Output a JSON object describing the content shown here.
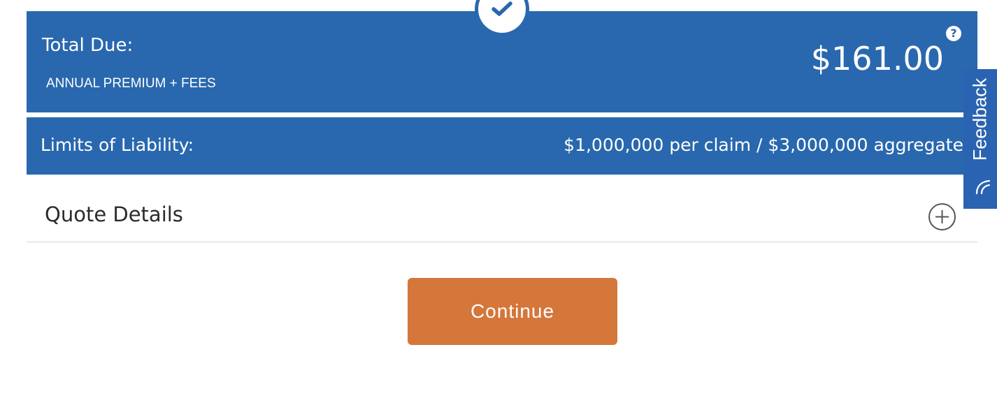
{
  "summary": {
    "total_label": "Total Due:",
    "total_sublabel": "ANNUAL PREMIUM + FEES",
    "total_amount": "$161.00",
    "help_icon": "?"
  },
  "limits": {
    "label": "Limits of Liability:",
    "value": "$1,000,000 per claim / $3,000,000 aggregate"
  },
  "quote_details": {
    "title": "Quote Details",
    "toggle_icon": "plus-circle-icon"
  },
  "actions": {
    "continue_label": "Continue"
  },
  "feedback": {
    "label": "Feedback"
  },
  "colors": {
    "panel_blue": "#2968ae",
    "button_orange": "#d5763a",
    "feedback_blue": "#2a63b1"
  }
}
